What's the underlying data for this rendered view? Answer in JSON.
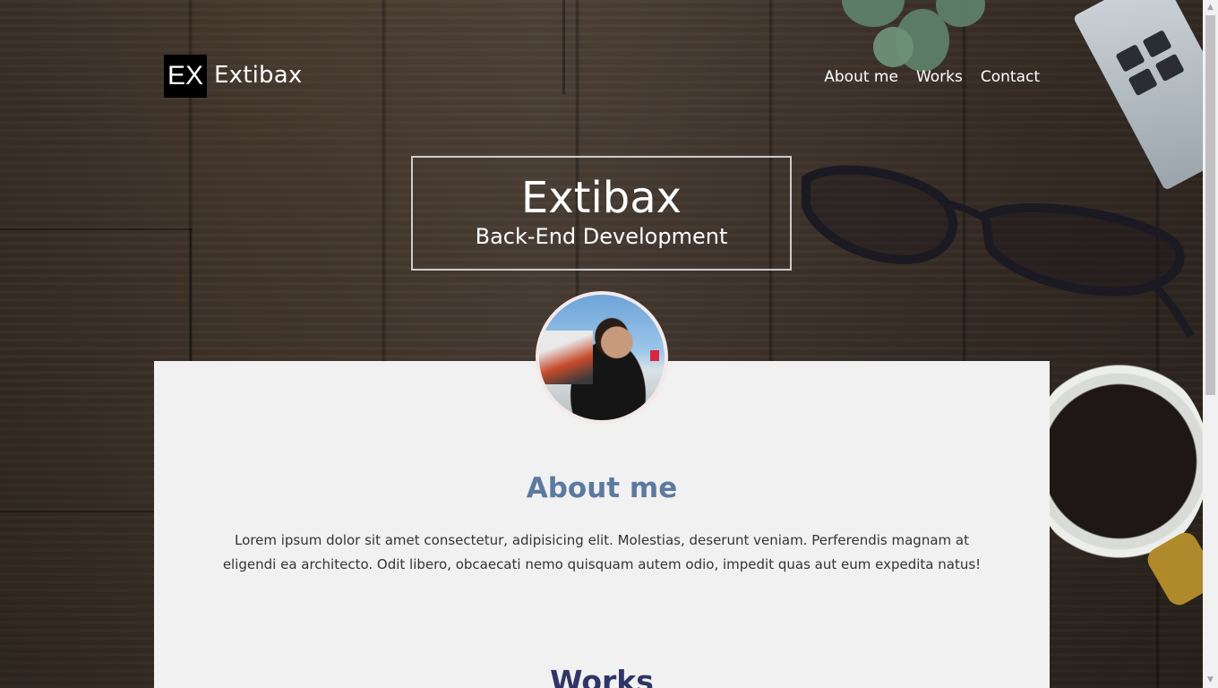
{
  "header": {
    "logo_mark": "EX",
    "logo_text": "Extibax",
    "nav": [
      "About me",
      "Works",
      "Contact"
    ]
  },
  "hero": {
    "title": "Extibax",
    "subtitle": "Back-End Development"
  },
  "about": {
    "title": "About me",
    "text": "Lorem ipsum dolor sit amet consectetur, adipisicing elit. Molestias, deserunt veniam. Perferendis magnam at eligendi ea architecto. Odit libero, obcaecati nemo quisquam autem odio, impedit quas aut eum expedita natus!"
  },
  "works": {
    "title": "Works"
  },
  "scrollbar": {
    "up": "▲",
    "down": "▼"
  },
  "colors": {
    "about_title": "#5c7aa0",
    "works_title": "#2f3566",
    "card_bg": "#f1f1f1"
  }
}
